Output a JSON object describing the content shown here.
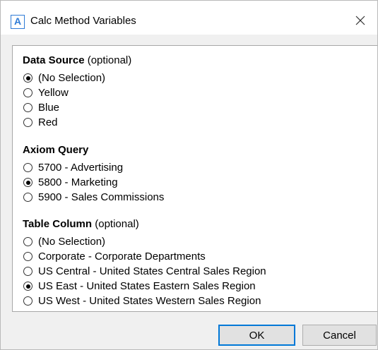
{
  "window": {
    "title": "Calc Method Variables",
    "icon_letter": "A",
    "icon": "app-logo-icon",
    "close_icon": "close-icon"
  },
  "sections": [
    {
      "title": "Data Source",
      "qualifier": "(optional)",
      "options": [
        {
          "label": "(No Selection)",
          "selected": true
        },
        {
          "label": "Yellow",
          "selected": false
        },
        {
          "label": "Blue",
          "selected": false
        },
        {
          "label": "Red",
          "selected": false
        }
      ]
    },
    {
      "title": "Axiom Query",
      "qualifier": "",
      "options": [
        {
          "label": "5700 - Advertising",
          "selected": false
        },
        {
          "label": "5800 - Marketing",
          "selected": true
        },
        {
          "label": "5900 - Sales Commissions",
          "selected": false
        }
      ]
    },
    {
      "title": "Table Column",
      "qualifier": "(optional)",
      "options": [
        {
          "label": "(No Selection)",
          "selected": false
        },
        {
          "label": "Corporate - Corporate Departments",
          "selected": false
        },
        {
          "label": "US Central - United States Central Sales Region",
          "selected": false
        },
        {
          "label": "US East - United States Eastern Sales Region",
          "selected": true
        },
        {
          "label": "US West - United States Western Sales Region",
          "selected": false
        }
      ]
    }
  ],
  "buttons": {
    "ok_label": "OK",
    "cancel_label": "Cancel"
  },
  "colors": {
    "accent": "#0078d7",
    "icon_blue": "#2f7bd6",
    "dialog_bg": "#f0f0f0"
  }
}
